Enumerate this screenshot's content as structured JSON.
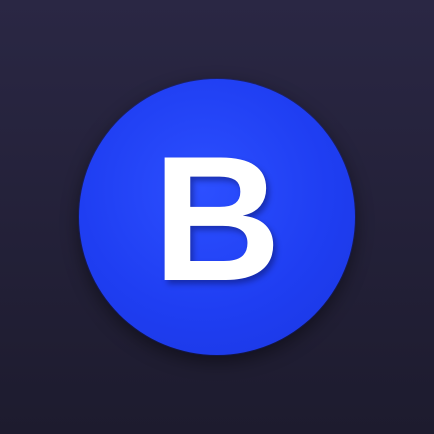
{
  "app_icon": {
    "letter": "B",
    "colors": {
      "background_top": "#2a2744",
      "background_bottom": "#1d1b2e",
      "circle": "#1f3ef2",
      "letter": "#ffffff"
    }
  }
}
